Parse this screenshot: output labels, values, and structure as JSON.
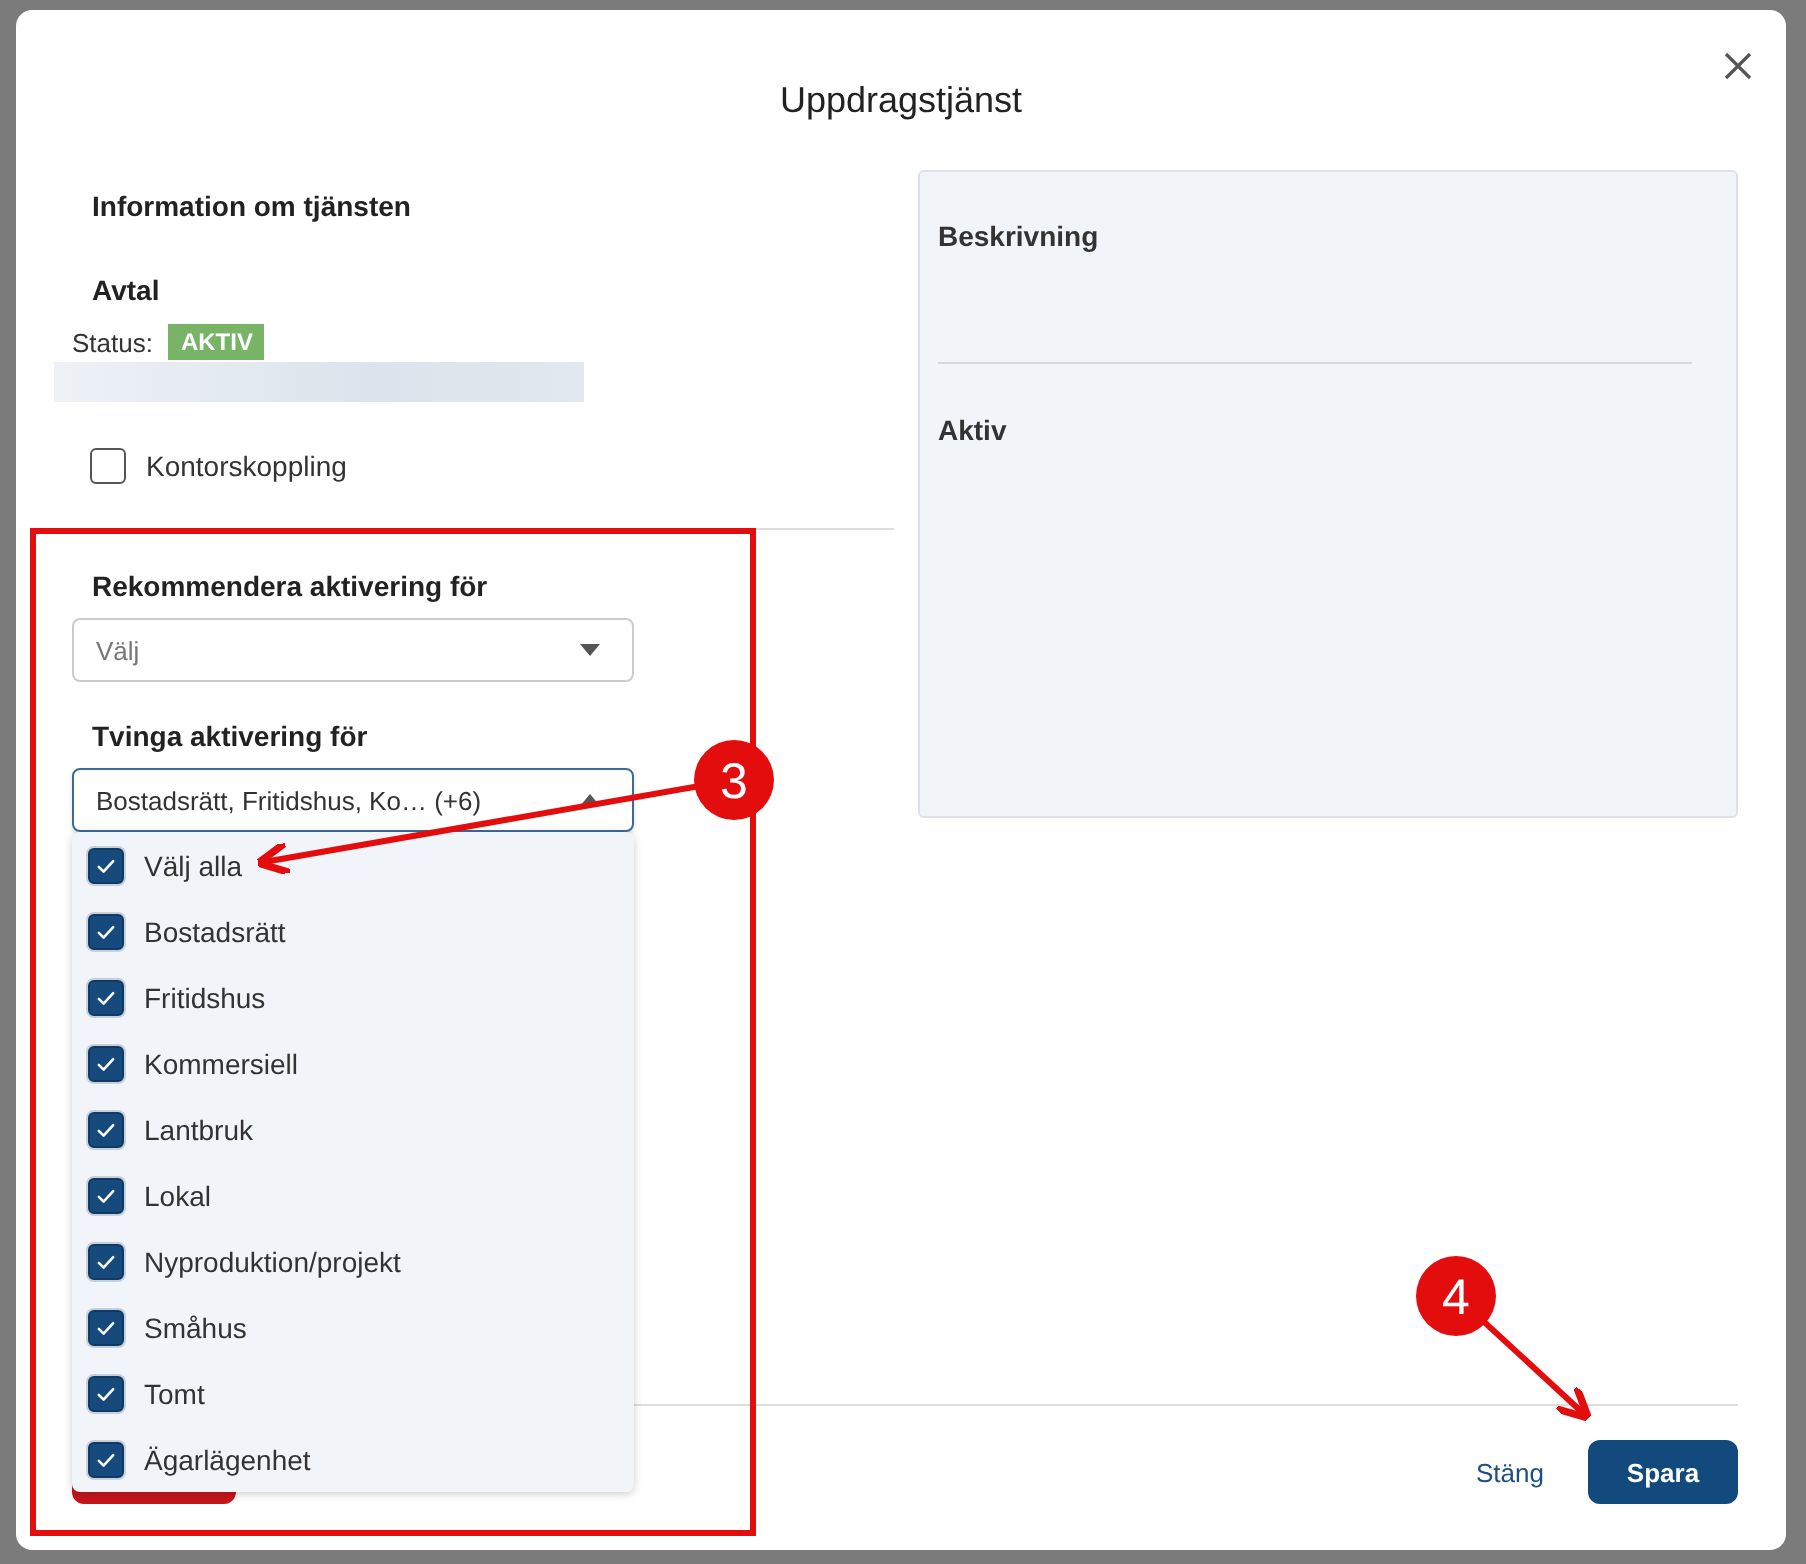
{
  "dialog": {
    "title": "Uppdragstjänst"
  },
  "info_heading": "Information om tjänsten",
  "agreement": {
    "heading": "Avtal",
    "status_label": "Status:",
    "status_badge": "AKTIV"
  },
  "office_link": {
    "label": "Kontorskoppling",
    "checked": false
  },
  "recommend": {
    "label": "Rekommendera aktivering för",
    "placeholder": "Välj",
    "expanded": false
  },
  "force": {
    "label": "Tvinga aktivering för",
    "value": "Bostadsrätt, Fritidshus, Ko… (+6)",
    "expanded": true,
    "options": [
      {
        "label": "Välj alla",
        "checked": true
      },
      {
        "label": "Bostadsrätt",
        "checked": true
      },
      {
        "label": "Fritidshus",
        "checked": true
      },
      {
        "label": "Kommersiell",
        "checked": true
      },
      {
        "label": "Lantbruk",
        "checked": true
      },
      {
        "label": "Lokal",
        "checked": true
      },
      {
        "label": "Nyproduktion/projekt",
        "checked": true
      },
      {
        "label": "Småhus",
        "checked": true
      },
      {
        "label": "Tomt",
        "checked": true
      },
      {
        "label": "Ägarlägenhet",
        "checked": true
      }
    ]
  },
  "side_panel": {
    "sections": [
      "Beskrivning",
      "Aktiv"
    ]
  },
  "footer": {
    "buttons": [
      {
        "kind": "danger"
      },
      {
        "label": "Stäng",
        "kind": "link"
      },
      {
        "label": "Spara",
        "kind": "primary"
      }
    ]
  },
  "annotations": [
    {
      "label": "3"
    },
    {
      "label": "4"
    }
  ]
}
